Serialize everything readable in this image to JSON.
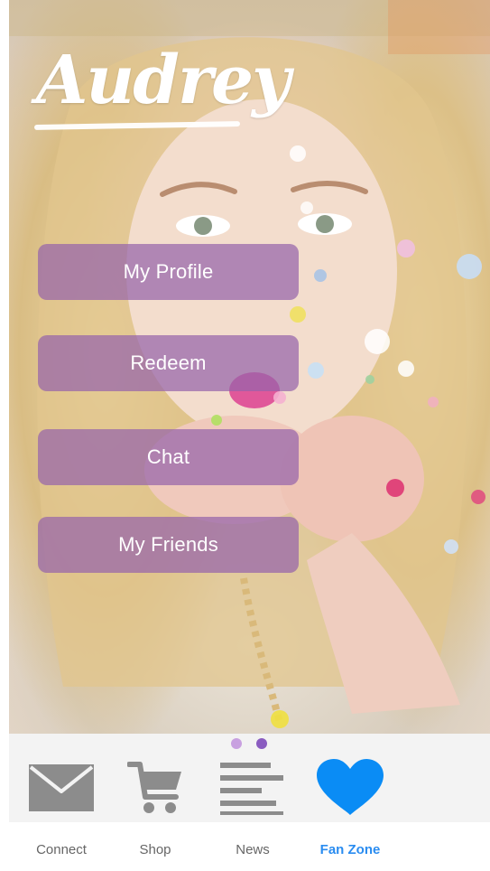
{
  "profile": {
    "name": "Audrey"
  },
  "menu": {
    "items": [
      {
        "label": "My Profile"
      },
      {
        "label": "Redeem"
      },
      {
        "label": "Chat"
      },
      {
        "label": "My Friends"
      }
    ],
    "button_color": "#9664aa"
  },
  "tabbar": {
    "tabs": [
      {
        "label": "Connect",
        "icon": "envelope-icon"
      },
      {
        "label": "Shop",
        "icon": "shopping-cart-icon"
      },
      {
        "label": "News",
        "icon": "news-list-icon"
      },
      {
        "label": "Fan Zone",
        "icon": "heart-icon",
        "active": true
      }
    ],
    "active_color": "#2a8cf0",
    "inactive_color": "#666666",
    "icon_color": "#8c8c8c",
    "page_dot_colors": [
      "#c8a0e0",
      "#8a5cc0"
    ]
  }
}
